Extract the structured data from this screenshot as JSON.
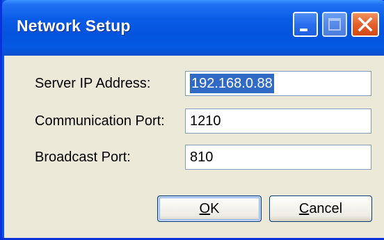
{
  "window": {
    "title": "Network Setup",
    "buttons": {
      "minimize_icon": "minimize-icon",
      "maximize_icon": "maximize-icon",
      "close_icon": "close-icon"
    }
  },
  "form": {
    "server_ip": {
      "label": "Server IP Address:",
      "value": "192.168.0.88",
      "selected": true
    },
    "comm_port": {
      "label": "Communication Port:",
      "value": "1210"
    },
    "broadcast_port": {
      "label": "Broadcast Port:",
      "value": "810"
    }
  },
  "actions": {
    "ok": {
      "mnemonic": "O",
      "rest": "K"
    },
    "cancel": {
      "mnemonic": "C",
      "rest": "ancel"
    }
  },
  "colors": {
    "titlebar": "#0454dd",
    "client_bg": "#ece9d8",
    "selection": "#316ac5",
    "close_button": "#e4602d"
  }
}
